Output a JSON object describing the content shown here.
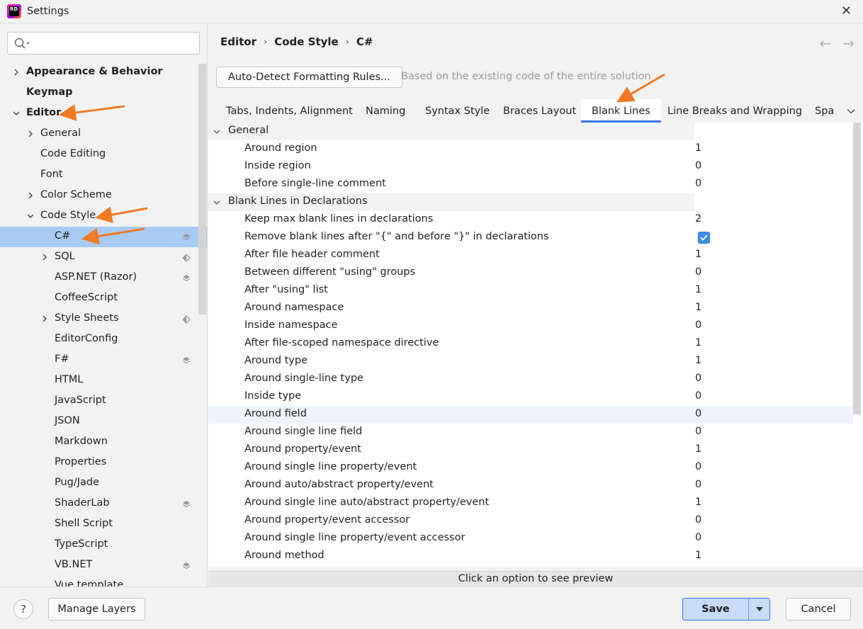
{
  "window": {
    "title": "Settings"
  },
  "search": {
    "placeholder": ""
  },
  "tree": [
    {
      "label": "Appearance & Behavior",
      "level": 0,
      "bold": true,
      "chevron": "right"
    },
    {
      "label": "Keymap",
      "level": 0,
      "bold": true,
      "chevron": "none"
    },
    {
      "label": "Editor",
      "level": 0,
      "bold": true,
      "chevron": "down"
    },
    {
      "label": "General",
      "level": 1,
      "chevron": "right"
    },
    {
      "label": "Code Editing",
      "level": 1,
      "chevron": "none"
    },
    {
      "label": "Font",
      "level": 1,
      "chevron": "none"
    },
    {
      "label": "Color Scheme",
      "level": 1,
      "chevron": "right"
    },
    {
      "label": "Code Style",
      "level": 1,
      "chevron": "down"
    },
    {
      "label": "C#",
      "level": 2,
      "chevron": "none",
      "selected": true,
      "icon": "layer-icon"
    },
    {
      "label": "SQL",
      "level": 2,
      "chevron": "right",
      "icon": "half-layer-icon"
    },
    {
      "label": "ASP.NET (Razor)",
      "level": 2,
      "chevron": "none",
      "icon": "layer-icon"
    },
    {
      "label": "CoffeeScript",
      "level": 2,
      "chevron": "none"
    },
    {
      "label": "Style Sheets",
      "level": 2,
      "chevron": "right",
      "icon": "half-layer-icon"
    },
    {
      "label": "EditorConfig",
      "level": 2,
      "chevron": "none"
    },
    {
      "label": "F#",
      "level": 2,
      "chevron": "none",
      "icon": "layer-icon"
    },
    {
      "label": "HTML",
      "level": 2,
      "chevron": "none"
    },
    {
      "label": "JavaScript",
      "level": 2,
      "chevron": "none"
    },
    {
      "label": "JSON",
      "level": 2,
      "chevron": "none"
    },
    {
      "label": "Markdown",
      "level": 2,
      "chevron": "none"
    },
    {
      "label": "Properties",
      "level": 2,
      "chevron": "none"
    },
    {
      "label": "Pug/Jade",
      "level": 2,
      "chevron": "none"
    },
    {
      "label": "ShaderLab",
      "level": 2,
      "chevron": "none",
      "icon": "layer-icon"
    },
    {
      "label": "Shell Script",
      "level": 2,
      "chevron": "none"
    },
    {
      "label": "TypeScript",
      "level": 2,
      "chevron": "none"
    },
    {
      "label": "VB.NET",
      "level": 2,
      "chevron": "none",
      "icon": "layer-icon"
    },
    {
      "label": "Vue template",
      "level": 2,
      "chevron": "none"
    }
  ],
  "breadcrumb": [
    "Editor",
    "Code Style",
    "C#"
  ],
  "nav": {
    "back": "←",
    "forward": "→"
  },
  "autodetect": {
    "button_label": "Auto-Detect Formatting Rules...",
    "hint": "Based on the existing code of the entire solution"
  },
  "tabs": [
    {
      "label": "Tabs, Indents, Alignment"
    },
    {
      "label": "Naming"
    },
    {
      "label": "Syntax Style"
    },
    {
      "label": "Braces Layout"
    },
    {
      "label": "Blank Lines",
      "active": true
    },
    {
      "label": "Line Breaks and Wrapping"
    },
    {
      "label": "Spa"
    }
  ],
  "options": [
    {
      "type": "group",
      "label": "General"
    },
    {
      "type": "option",
      "label": "Around region",
      "value": "1"
    },
    {
      "type": "option",
      "label": "Inside region",
      "value": "0"
    },
    {
      "type": "option",
      "label": "Before single-line comment",
      "value": "0"
    },
    {
      "type": "group",
      "label": "Blank Lines in Declarations"
    },
    {
      "type": "option",
      "label": "Keep max blank lines in declarations",
      "value": "2"
    },
    {
      "type": "checkbox",
      "label": "Remove blank lines after \"{\" and before \"}\" in declarations",
      "checked": true
    },
    {
      "type": "option",
      "label": "After file header comment",
      "value": "1"
    },
    {
      "type": "option",
      "label": "Between different \"using\" groups",
      "value": "0"
    },
    {
      "type": "option",
      "label": "After \"using\" list",
      "value": "1"
    },
    {
      "type": "option",
      "label": "Around namespace",
      "value": "1"
    },
    {
      "type": "option",
      "label": "Inside namespace",
      "value": "0"
    },
    {
      "type": "option",
      "label": "After file-scoped namespace directive",
      "value": "1"
    },
    {
      "type": "option",
      "label": "Around type",
      "value": "1"
    },
    {
      "type": "option",
      "label": "Around single-line type",
      "value": "0"
    },
    {
      "type": "option",
      "label": "Inside type",
      "value": "0"
    },
    {
      "type": "option",
      "label": "Around field",
      "value": "0",
      "highlight": true
    },
    {
      "type": "option",
      "label": "Around single line field",
      "value": "0"
    },
    {
      "type": "option",
      "label": "Around property/event",
      "value": "1"
    },
    {
      "type": "option",
      "label": "Around single line property/event",
      "value": "0"
    },
    {
      "type": "option",
      "label": "Around auto/abstract property/event",
      "value": "0"
    },
    {
      "type": "option",
      "label": "Around single line auto/abstract property/event",
      "value": "1"
    },
    {
      "type": "option",
      "label": "Around property/event accessor",
      "value": "0"
    },
    {
      "type": "option",
      "label": "Around single line property/event accessor",
      "value": "0"
    },
    {
      "type": "option",
      "label": "Around method",
      "value": "1"
    }
  ],
  "preview": {
    "text": "Click an option to see preview"
  },
  "footer": {
    "help_label": "?",
    "manage_layers_label": "Manage Layers",
    "save_label": "Save",
    "cancel_label": "Cancel"
  },
  "colors": {
    "accent": "#3574f0",
    "selection": "#a8cbf5",
    "annotation": "#f07a22",
    "checkbox": "#3d8ee8"
  }
}
